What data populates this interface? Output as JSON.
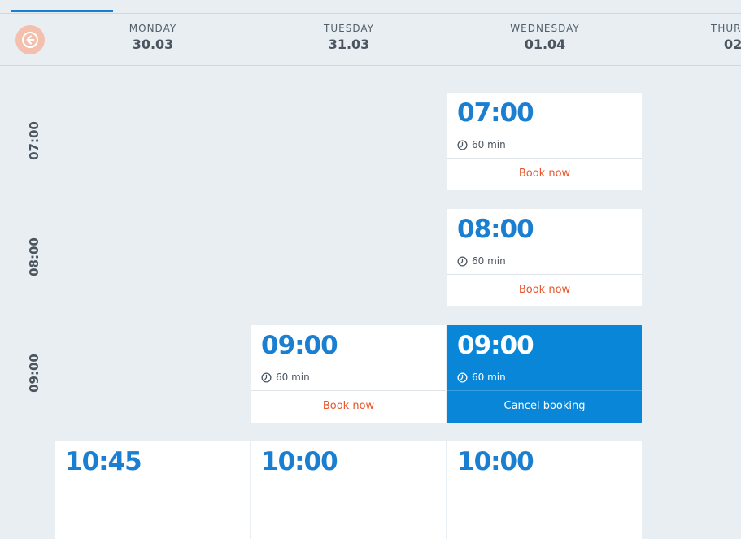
{
  "header": {
    "days": [
      {
        "name": "MONDAY",
        "date": "30.03"
      },
      {
        "name": "TUESDAY",
        "date": "31.03"
      },
      {
        "name": "WEDNESDAY",
        "date": "01.04"
      },
      {
        "name": "THUR",
        "date": "02."
      }
    ]
  },
  "time_labels": [
    "07:00",
    "08:00",
    "09:00"
  ],
  "slots": {
    "wed_0700": {
      "time": "07:00",
      "duration": "60 min",
      "action": "Book now"
    },
    "wed_0800": {
      "time": "08:00",
      "duration": "60 min",
      "action": "Book now"
    },
    "tue_0900": {
      "time": "09:00",
      "duration": "60 min",
      "action": "Book now"
    },
    "wed_0900": {
      "time": "09:00",
      "duration": "60 min",
      "action": "Cancel booking"
    },
    "mon_1045": {
      "time": "10:45"
    },
    "tue_1000": {
      "time": "10:00"
    },
    "wed_1000": {
      "time": "10:00"
    }
  },
  "colors": {
    "accent": "#1a7fd0",
    "booked_bg": "#0a86d8",
    "action": "#e8542a",
    "prev_button": "#f4bfad"
  }
}
